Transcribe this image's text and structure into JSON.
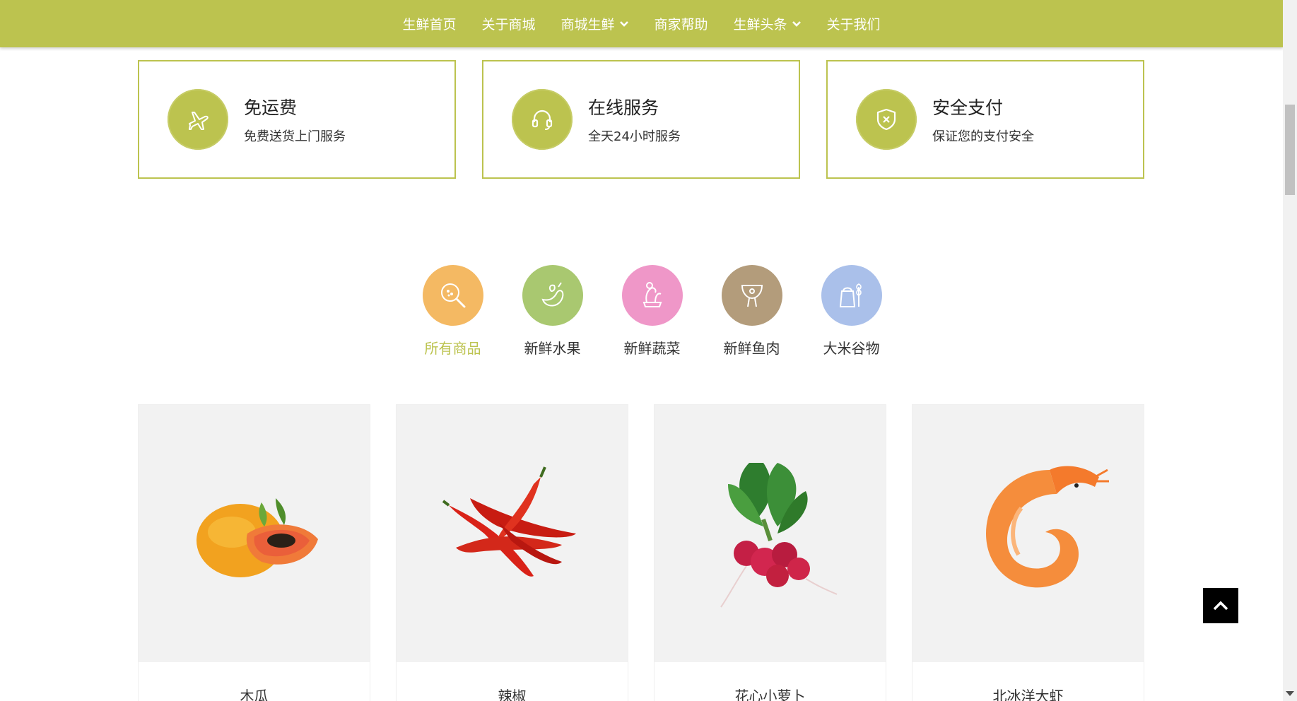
{
  "nav": {
    "items": [
      {
        "label": "生鲜首页",
        "has_dropdown": false
      },
      {
        "label": "关于商城",
        "has_dropdown": false
      },
      {
        "label": "商城生鲜",
        "has_dropdown": true
      },
      {
        "label": "商家帮助",
        "has_dropdown": false
      },
      {
        "label": "生鲜头条",
        "has_dropdown": true
      },
      {
        "label": "关于我们",
        "has_dropdown": false
      }
    ]
  },
  "features": [
    {
      "title": "免运费",
      "subtitle": "免费送货上门服务",
      "icon": "airplane-icon"
    },
    {
      "title": "在线服务",
      "subtitle": "全天24小时服务",
      "icon": "headset-icon"
    },
    {
      "title": "安全支付",
      "subtitle": "保证您的支付安全",
      "icon": "shield-icon"
    }
  ],
  "categories": [
    {
      "label": "所有商品",
      "icon": "search-icon",
      "color": "#f4b963",
      "active": true
    },
    {
      "label": "新鲜水果",
      "icon": "fruit-icon",
      "color": "#a9c870",
      "active": false
    },
    {
      "label": "新鲜蔬菜",
      "icon": "vegetable-icon",
      "color": "#ef97c8",
      "active": false
    },
    {
      "label": "新鲜鱼肉",
      "icon": "meat-icon",
      "color": "#b39c7b",
      "active": false
    },
    {
      "label": "大米谷物",
      "icon": "grain-icon",
      "color": "#aac0ea",
      "active": false
    }
  ],
  "products": [
    {
      "name": "木瓜",
      "image": "papaya-image"
    },
    {
      "name": "辣椒",
      "image": "chili-image"
    },
    {
      "name": "花心小萝卜",
      "image": "radish-image"
    },
    {
      "name": "北冰洋大虾",
      "image": "shrimp-image"
    }
  ],
  "colors": {
    "brand": "#bcc34f",
    "text": "#333333",
    "card_bg": "#f2f2f2"
  }
}
